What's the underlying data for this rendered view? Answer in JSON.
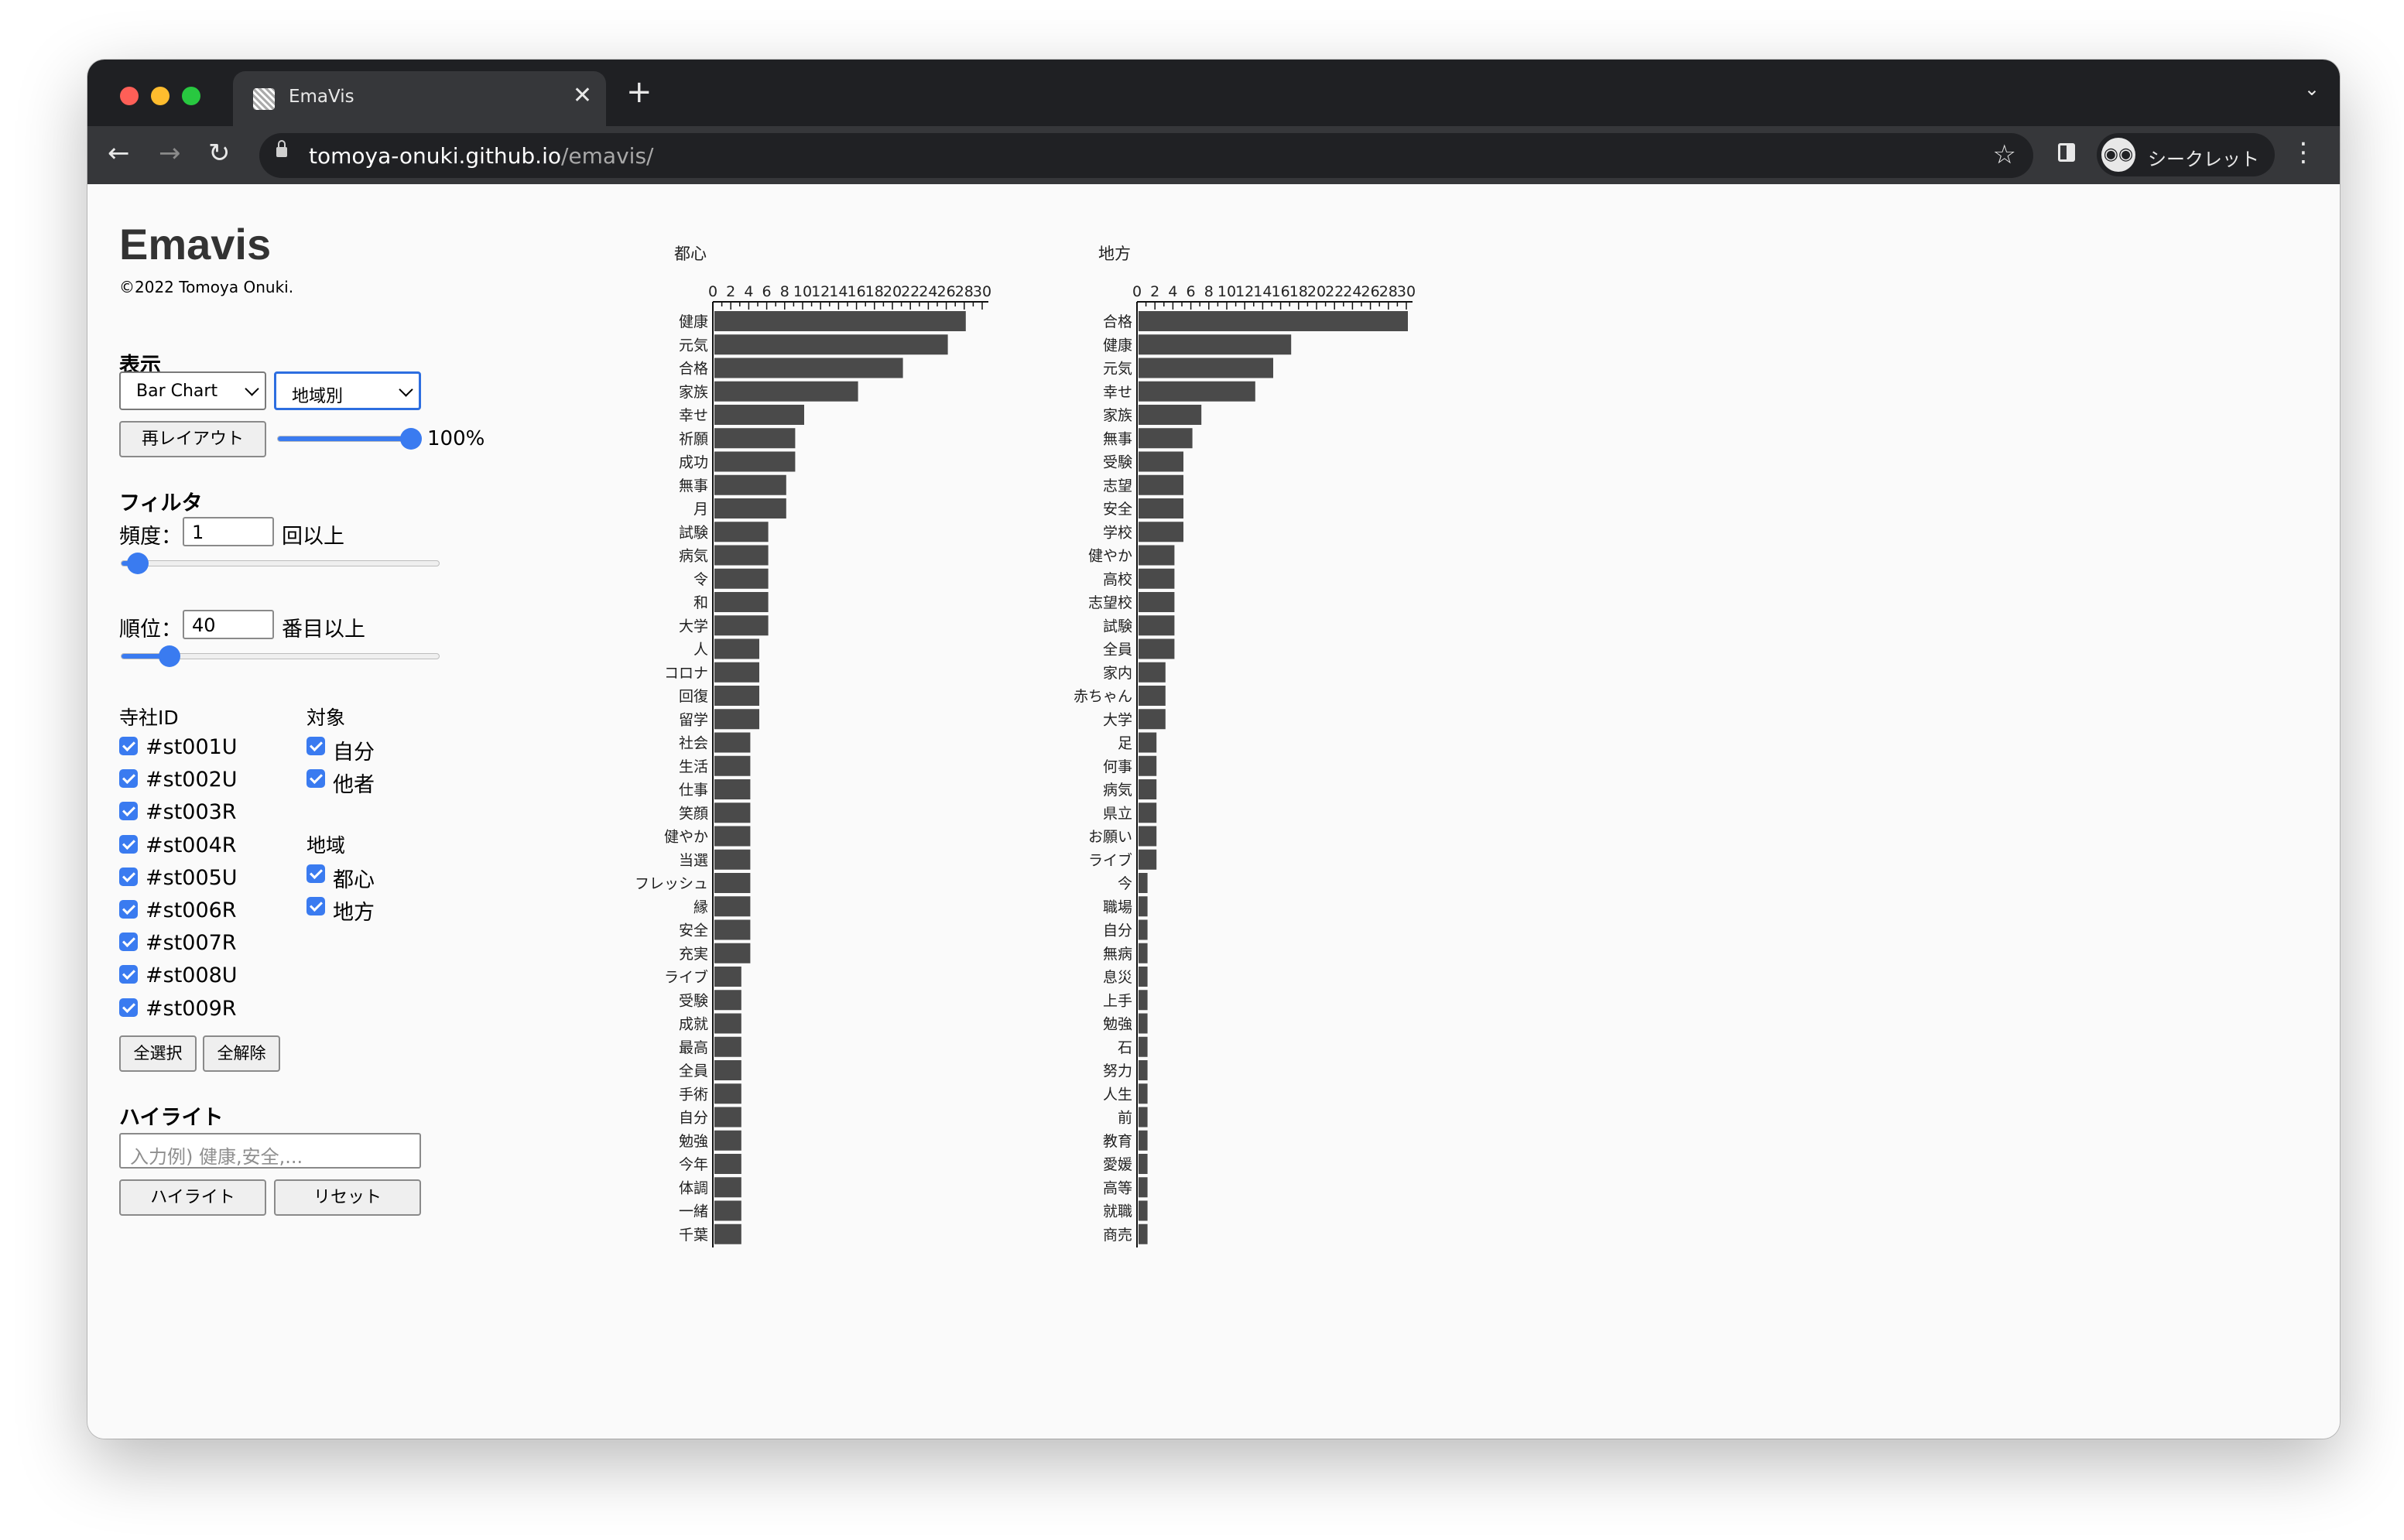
{
  "browser": {
    "tab_title": "EmaVis",
    "close_glyph": "✕",
    "newtab_glyph": "+",
    "tab_menu_glyph": "⌄",
    "back_glyph": "←",
    "forward_glyph": "→",
    "reload_glyph": "↻",
    "url_host": "tomoya-onuki.github.io",
    "url_path": "/emavis/",
    "star_glyph": "☆",
    "incognito_label": "シークレット",
    "menu_glyph": "⋮"
  },
  "sidebar": {
    "title": "Emavis",
    "copyright": "©2022 Tomoya Onuki.",
    "display_heading": "表示",
    "chart_select_value": "Bar Chart",
    "group_select_value": "地域別",
    "relayout_label": "再レイアウト",
    "zoom_percent": "100%",
    "zoom_value": 100,
    "filter_heading": "フィルタ",
    "freq_label": "頻度：",
    "freq_value": "1",
    "freq_suffix": "回以上",
    "freq_slider_fraction": 0.05,
    "rank_label": "順位：",
    "rank_value": "40",
    "rank_suffix": "番目以上",
    "rank_slider_fraction": 0.15,
    "shrine_heading": "寺社ID",
    "shrine_ids": [
      "#st001U",
      "#st002U",
      "#st003R",
      "#st004R",
      "#st005U",
      "#st006R",
      "#st007R",
      "#st008U",
      "#st009R"
    ],
    "target_heading": "対象",
    "targets": [
      "自分",
      "他者"
    ],
    "region_heading": "地域",
    "regions": [
      "都心",
      "地方"
    ],
    "select_all_label": "全選択",
    "clear_all_label": "全解除",
    "highlight_heading": "ハイライト",
    "highlight_placeholder": "入力例) 健康,安全,...",
    "highlight_button_label": "ハイライト",
    "reset_button_label": "リセット"
  },
  "chart_data": [
    {
      "type": "bar",
      "title": "都心",
      "xlim": [
        0,
        30
      ],
      "xticks": [
        0,
        2,
        4,
        6,
        8,
        10,
        12,
        14,
        16,
        18,
        20,
        22,
        24,
        26,
        28,
        30
      ],
      "bar_color": "#4a4a4a",
      "categories": [
        "健康",
        "元気",
        "合格",
        "家族",
        "幸せ",
        "祈願",
        "成功",
        "無事",
        "月",
        "試験",
        "病気",
        "令",
        "和",
        "大学",
        "人",
        "コロナ",
        "回復",
        "留学",
        "社会",
        "生活",
        "仕事",
        "笑顔",
        "健やか",
        "当選",
        "フレッシュ",
        "縁",
        "安全",
        "充実",
        "ライブ",
        "受験",
        "成就",
        "最高",
        "全員",
        "手術",
        "自分",
        "勉強",
        "今年",
        "体調",
        "一緒",
        "千葉"
      ],
      "values": [
        28,
        26,
        21,
        16,
        10,
        9,
        9,
        8,
        8,
        6,
        6,
        6,
        6,
        6,
        5,
        5,
        5,
        5,
        4,
        4,
        4,
        4,
        4,
        4,
        4,
        4,
        4,
        4,
        3,
        3,
        3,
        3,
        3,
        3,
        3,
        3,
        3,
        3,
        3,
        3
      ]
    },
    {
      "type": "bar",
      "title": "地方",
      "xlim": [
        0,
        30
      ],
      "xticks": [
        0,
        2,
        4,
        6,
        8,
        10,
        12,
        14,
        16,
        18,
        20,
        22,
        24,
        26,
        28,
        30
      ],
      "bar_color": "#4a4a4a",
      "categories": [
        "合格",
        "健康",
        "元気",
        "幸せ",
        "家族",
        "無事",
        "受験",
        "志望",
        "安全",
        "学校",
        "健やか",
        "高校",
        "志望校",
        "試験",
        "全員",
        "家内",
        "赤ちゃん",
        "大学",
        "足",
        "何事",
        "病気",
        "県立",
        "お願い",
        "ライブ",
        "今",
        "職場",
        "自分",
        "無病",
        "息災",
        "上手",
        "勉強",
        "石",
        "努力",
        "人生",
        "前",
        "教育",
        "愛媛",
        "高等",
        "就職",
        "商売"
      ],
      "values": [
        30,
        17,
        15,
        13,
        7,
        6,
        5,
        5,
        5,
        5,
        4,
        4,
        4,
        4,
        4,
        3,
        3,
        3,
        2,
        2,
        2,
        2,
        2,
        2,
        1,
        1,
        1,
        1,
        1,
        1,
        1,
        1,
        1,
        1,
        1,
        1,
        1,
        1,
        1,
        1
      ]
    }
  ]
}
